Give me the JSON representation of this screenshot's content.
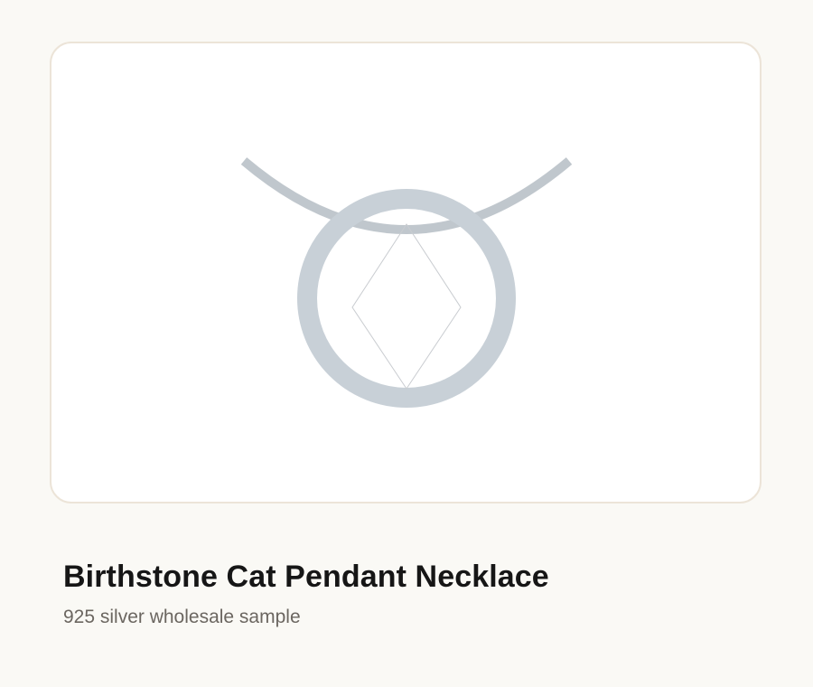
{
  "product": {
    "title": "Birthstone Cat Pendant Necklace",
    "subtitle": "925 silver wholesale sample"
  },
  "image": {
    "icon": "pendant-necklace-illustration",
    "colors": {
      "metal": "#c8d0d7",
      "gem_outline": "#c9ccd0",
      "card_background": "#ffffff",
      "card_border": "#ece4d8",
      "page_background": "#faf9f5"
    }
  }
}
